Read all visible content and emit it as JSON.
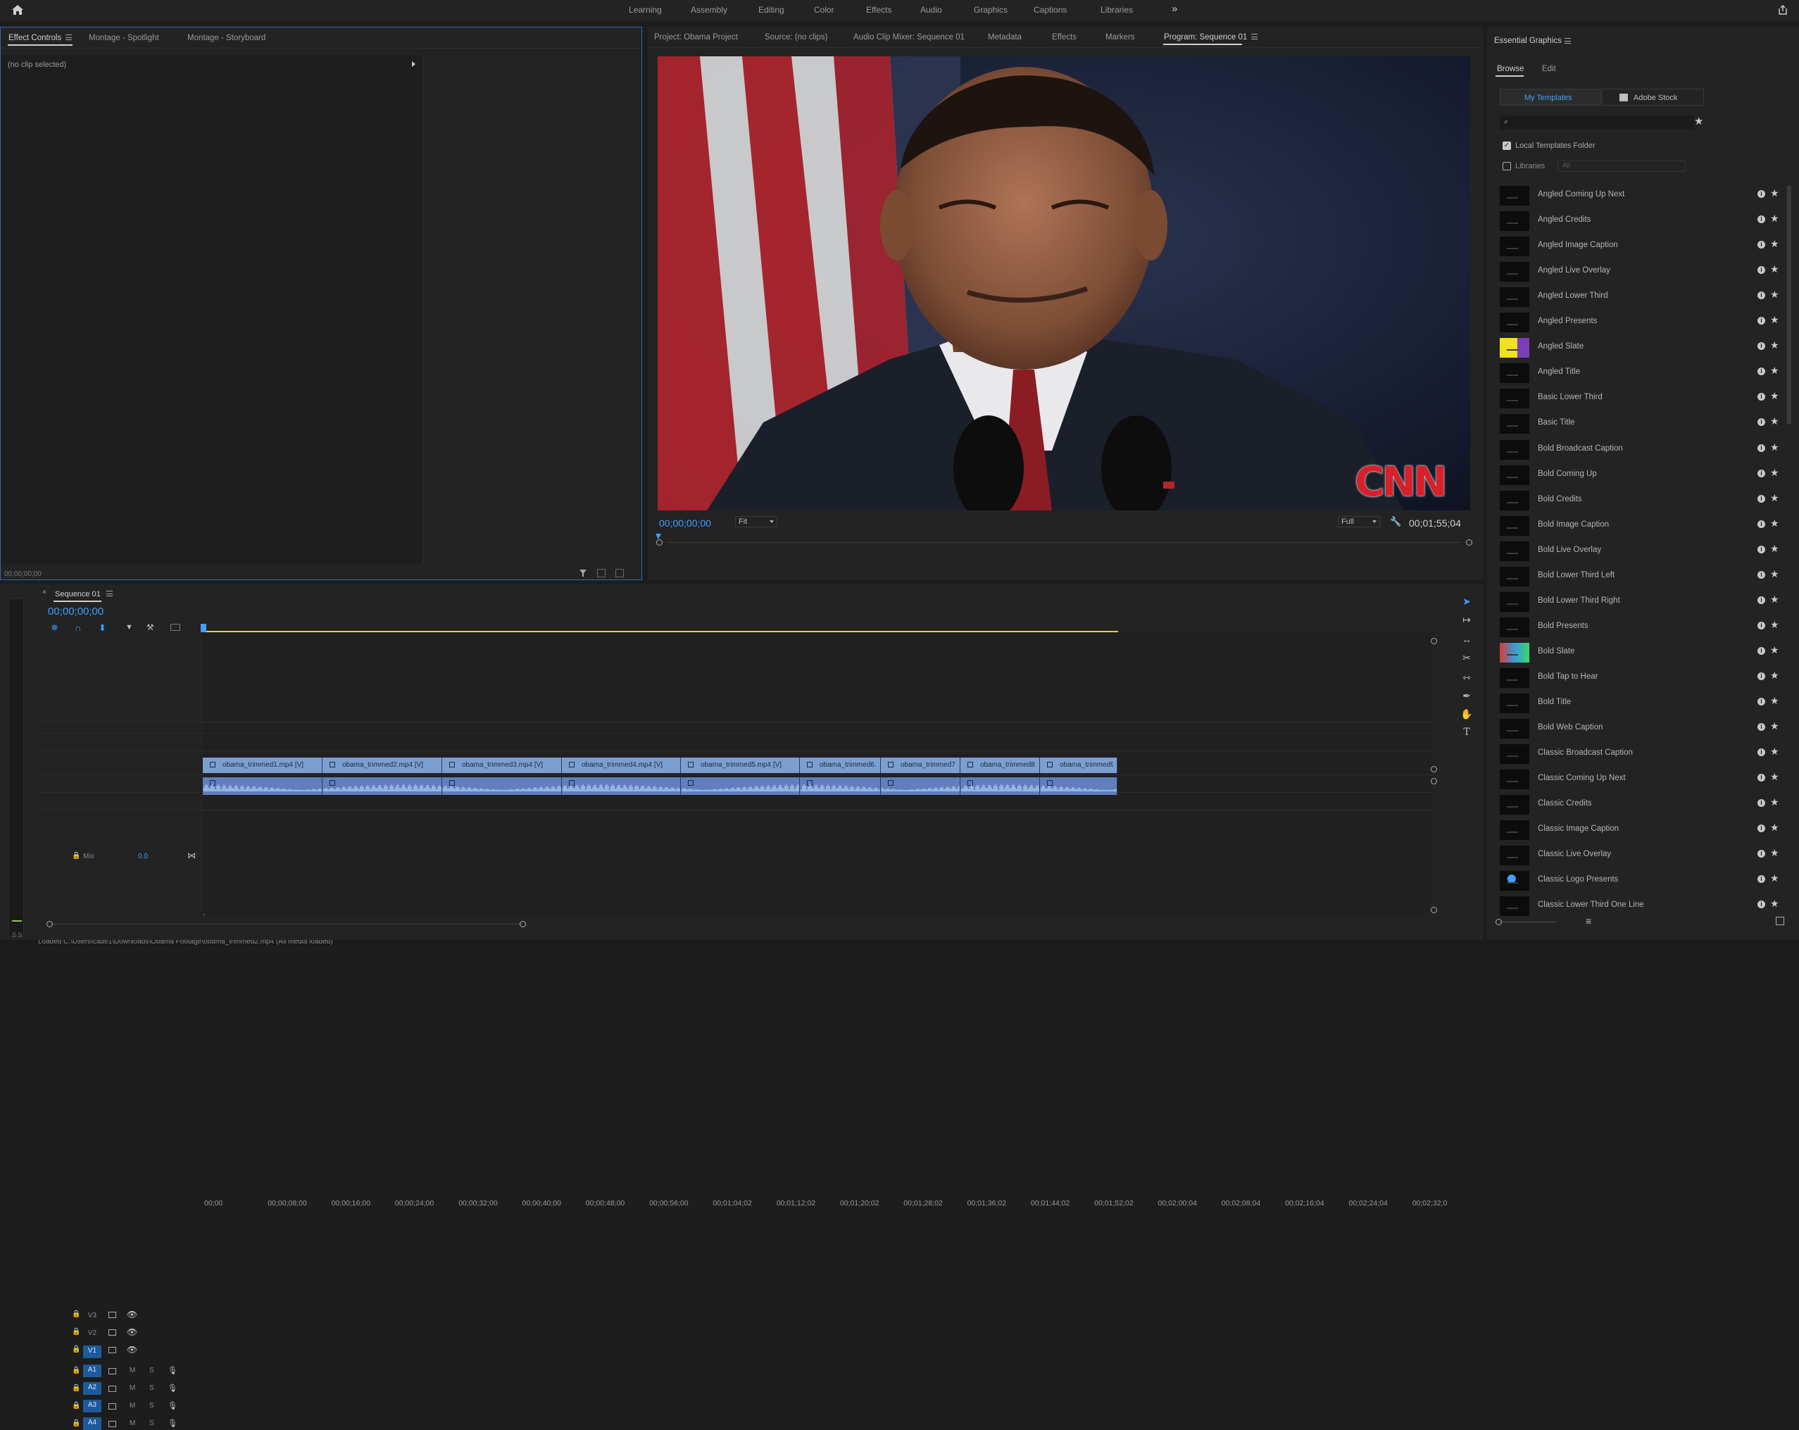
{
  "workspaces": {
    "tabs": [
      "Learning",
      "Assembly",
      "Editing",
      "Color",
      "Effects",
      "Audio",
      "Graphics",
      "Captions",
      "Libraries"
    ],
    "more": "»"
  },
  "effect_controls": {
    "tabs": [
      "Effect Controls",
      "Montage - Spotlight",
      "Montage - Storyboard"
    ],
    "no_clip": "(no clip selected)",
    "timecode": "00;00;00;00"
  },
  "program": {
    "tabs": [
      "Project: Obama Project",
      "Source: (no clips)",
      "Audio Clip Mixer: Sequence 01",
      "Metadata",
      "Effects",
      "Markers",
      "Program: Sequence 01"
    ],
    "current_timecode": "00;00;00;00",
    "zoom": "Fit",
    "resolution": "Full",
    "duration": "00;01;55;04",
    "watermark": "CNN"
  },
  "timeline": {
    "sequence_tab": "Sequence 01",
    "timecode": "00;00;00;00",
    "ruler": [
      "00;00",
      "00;00;08;00",
      "00;00;16;00",
      "00;00;24;00",
      "00;00;32;00",
      "00;00;40;00",
      "00;00;48;00",
      "00;00;56;00",
      "00;01;04;02",
      "00;01;12;02",
      "00;01;20;02",
      "00;01;28;02",
      "00;01;36;02",
      "00;01;44;02",
      "00;01;52;02",
      "00;02;00;04",
      "00;02;08;04",
      "00;02;16;04",
      "00;02;24;04",
      "00;02;32;0"
    ],
    "video_tracks": [
      "V3",
      "V2",
      "V1"
    ],
    "audio_tracks": [
      "A1",
      "A2",
      "A3",
      "A4"
    ],
    "mute": "M",
    "solo": "S",
    "mix_label": "Mix",
    "mix_value": "0.0",
    "clips": [
      "obama_trimmed1.mp4 [V]",
      "obama_trimmed2.mp4 [V]",
      "obama_trimmed3.mp4 [V]",
      "obama_trimmed4.mp4 [V]",
      "obama_trimmed5.mp4 [V]",
      "obama_trimmed6.",
      "obama_trimmed7.",
      "obama_trimmed8.",
      "obama_trimmed9."
    ],
    "meter_label": "S S"
  },
  "essential_graphics": {
    "title": "Essential Graphics",
    "tabs": [
      "Browse",
      "Edit"
    ],
    "my_templates": "My Templates",
    "adobe_stock": "Adobe Stock",
    "local_templates": "Local Templates Folder",
    "libraries": "Libraries",
    "libraries_select": "All",
    "templates": [
      "Angled Coming Up Next",
      "Angled Credits",
      "Angled Image Caption",
      "Angled Live Overlay",
      "Angled Lower Third",
      "Angled Presents",
      "Angled Slate",
      "Angled Title",
      "Basic Lower Third",
      "Basic Title",
      "Bold Broadcast Caption",
      "Bold Coming Up",
      "Bold Credits",
      "Bold Image Caption",
      "Bold Live Overlay",
      "Bold Lower Third Left",
      "Bold Lower Third Right",
      "Bold Presents",
      "Bold Slate",
      "Bold Tap to Hear",
      "Bold Title",
      "Bold Web Caption",
      "Classic Broadcast Caption",
      "Classic Coming Up Next",
      "Classic Credits",
      "Classic Image Caption",
      "Classic Live Overlay",
      "Classic Logo Presents",
      "Classic Lower Third One Line"
    ]
  },
  "status_bar": {
    "text": "Loaded C:\\Users\\cade1\\Downloads\\Obama Footage\\obama_trimmed2.mp4 (All media loaded)"
  },
  "colors": {
    "accent": "#3fa0ff",
    "video_clip": "#7c9fd2",
    "audio_clip": "#5f7fbe",
    "work_area": "#e6d13a"
  }
}
